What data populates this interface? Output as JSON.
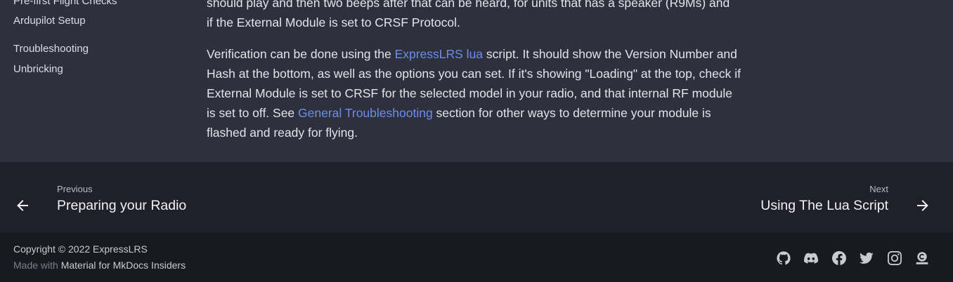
{
  "sidebar": {
    "items": [
      {
        "label": "Pre-first Flight Checks"
      },
      {
        "label": "Ardupilot Setup"
      },
      {
        "label": "Troubleshooting"
      },
      {
        "label": "Unbricking"
      }
    ]
  },
  "content": {
    "p1_line1": "should play and then two beeps after that can be heard, for units that has a speaker (R9Ms) and",
    "p1_line2": "if the External Module is set to CRSF Protocol.",
    "p2_before": "Verification can be done using the ",
    "p2_link1": "ExpressLRS lua",
    "p2_middle": " script. It should show the Version Number and Hash at the bottom, as well as the options you can set. If it's showing \"Loading\" at the top, check if External Module is set to CRSF for the selected model in your radio, and that internal RF module is set to off. See ",
    "p2_link2": "General Troubleshooting",
    "p2_after": " section for other ways to determine your module is flashed and ready for flying."
  },
  "pager": {
    "prev_label": "Previous",
    "prev_title": "Preparing your Radio",
    "next_label": "Next",
    "next_title": "Using The Lua Script"
  },
  "footer": {
    "copyright": "Copyright © 2022 ExpressLRS",
    "made_with": "Made with ",
    "made_with_link": "Material for MkDocs Insiders",
    "social_icons": [
      "github-icon",
      "discord-icon",
      "facebook-icon",
      "twitter-icon",
      "instagram-icon",
      "opencollective-icon"
    ]
  }
}
